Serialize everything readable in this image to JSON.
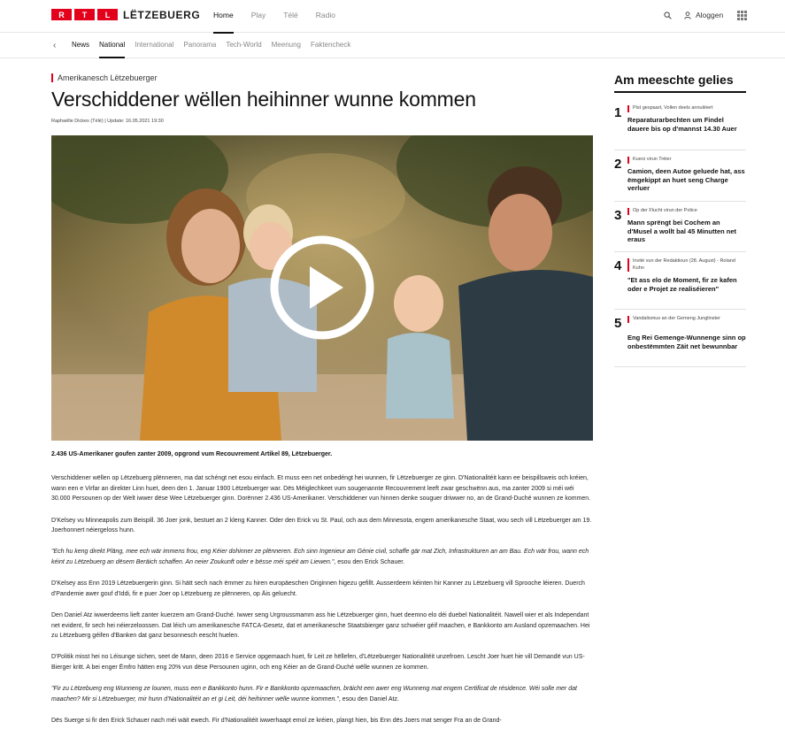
{
  "brand": {
    "box_letters": [
      "R",
      "T",
      "L"
    ],
    "word": "LËTZEBUERG",
    "accent": "#e3001b"
  },
  "main_nav": [
    "Home",
    "Play",
    "Télé",
    "Radio"
  ],
  "login_label": "Aloggen",
  "sub_nav": [
    "News",
    "National",
    "International",
    "Panorama",
    "Tech-World",
    "Meenung",
    "Faktencheck"
  ],
  "article": {
    "kicker": "Amerikanesch Lëtzebuerger",
    "headline": "Verschiddener wëllen heihinner wunne kommen",
    "byline": "Raphaëlle Dickes (Télé)  |  Update: 16.05.2021 19:30",
    "lead": "2.436 US-Amerikaner goufen zanter 2009, opgrond vum Recouvrement Artikel 89, Lëtzebuerger.",
    "paragraphs": [
      "Verschiddener wëllen op Lëtzebuerg plënneren, ma dat schéngt net esou einfach. Et muss een net onbedéngt hei wunnen, fir Lëtzebuerger ze ginn. D'Nationalitéit kann ee beispillsweis och kréien, wann een e Virfar an direkter Linn huet, deen den 1. Januar 1900 Lëtzebuerger war. Dës Méiglechkeet vum sougenannte Recouvrement leeft zwar geschwënn aus, ma zanter 2009 si méi wéi 30.000 Persounen op der Welt iwwer dëse Wee Lëtzebuerger ginn. Dorënner 2.436 US-Amerikaner. Verschiddener vun hinnen denke souguer driwwer no, an de Grand-Duché wunnen ze kommen.",
      "D'Kelsey vu Minneapolis zum Beispill. 36 Joer jonk, bestuet an 2 kleng Kanner. Oder den Erick vu St. Paul, och aus dem Minnesota, engem amerikanesche Staat, wou sech vill Lëtzebuerger am 19. Joerhonnert néiergeloss hunn."
    ],
    "quote1": "\"Ech hu keng direkt Pläng, mee ech wär immens frou, eng Kéier dohinner ze plënneren. Ech sinn Ingenieur am Génie civil, schaffe gär mat Zich, Infrastrukturen an am Bau. Ech wär frou, wann ech kéint zu Lëtzebuerg an dësem Beräich schaffen. An neier Zoukunft oder e bësse méi spéit am Liewen.\"",
    "quote1_attr": ", esou den Erick Schauer.",
    "paragraphs2": [
      "D'Kelsey ass Enn 2019 Lëtzebuergerin ginn. Si hätt sech nach ëmmer zu hiren europäeschen Originnen higezu gefillt. Ausserdeem kéinten hir Kanner zu Lëtzebuerg vill Sprooche léieren. Duerch d'Pandemie awer gouf d'Iddi, fir e puer Joer op Lëtzebuerg ze plënneren, op Äis geluecht.",
      "Den Daniel Atz iwwerdeems lieft zanter kuerzem am Grand-Duché. Iwwer seng Urgroussmamm ass hie Lëtzebuerger ginn, huet deemno elo déi duebel Nationalitéit. Nawell wier et als Independant net evident, fir sech hei néierzeloossen. Dat léich um amerikanesche FATCA-Gesetz, dat et amerikanesche Staatsbierger ganz schwéier géif maachen, e Bankkonto am Ausland opzemaachen. Hei zu Lëtzebuerg géifen d'Banken dat ganz besonnesch eescht huelen.",
      "D'Politik misst hei no Léisunge sichen, seet de Mann, deen 2016 e Service opgemaach huet, fir Leit ze hëllefen, d'Lëtzebuerger Nationalitéit unzefroen. Lescht Joer huet hie vill Demandë vun US-Bierger kritt. A bei enger Ëmfro hätten eng 20% vun dëse Persounen uginn, och eng Kéier an de Grand-Duché wëlle wunnen ze kommen."
    ],
    "quote2": "\"Fir zu Lëtzebuerg eng Wunneng ze lounen, muss een e Bankkonto hunn. Fir e Bankkonto opzemaachen, bräicht een awer eng Wunneng mat engem Certificat de résidence. Wéi solle mer dat maachen? Mir si Lëtzebuerger, mir hunn d'Nationalitéit an et gi Leit, déi heihinner wëlle wunne kommen.\"",
    "quote2_attr": ", esou den Daniel Atz.",
    "last_para": "Dës Suerge si fir den Erick Schauer nach méi wäit ewech. Fir d'Nationalitéit iwwerhaapt emol ze kréien, plangt hien, bis Enn dës Joers mat senger Fra an de Grand-"
  },
  "sidebar": {
    "title": "Am meeschte gelies",
    "items": [
      {
        "num": "1",
        "tag": "Pist gespaart, Vollen deels annuléiert",
        "title": "Reparaturarbechten um Findel dauere bis op d'mannst 14.30 Auer"
      },
      {
        "num": "2",
        "tag": "Kuerz virun Trèier",
        "title": "Camion, deen Autoe geluede hat, ass ëmgekippt an huet seng Charge verluer"
      },
      {
        "num": "3",
        "tag": "Op der Flucht virun der Police",
        "title": "Mann sprëngt bei Cochem an d'Musel a wollt bal 45 Minutten net eraus"
      },
      {
        "num": "4",
        "tag": "Invité vun der Redaktioun (28. August) - Roland Kuhn",
        "title": "\"Et ass elo de Moment, fir ze kafen oder e Projet ze realiséieren\""
      },
      {
        "num": "5",
        "tag": "Vandalismus an der Gemeng Junglinster",
        "title": "Eng Rei Gemenge-Wunnenge sinn op onbestëmmten Zäit net bewunnbar"
      }
    ]
  }
}
